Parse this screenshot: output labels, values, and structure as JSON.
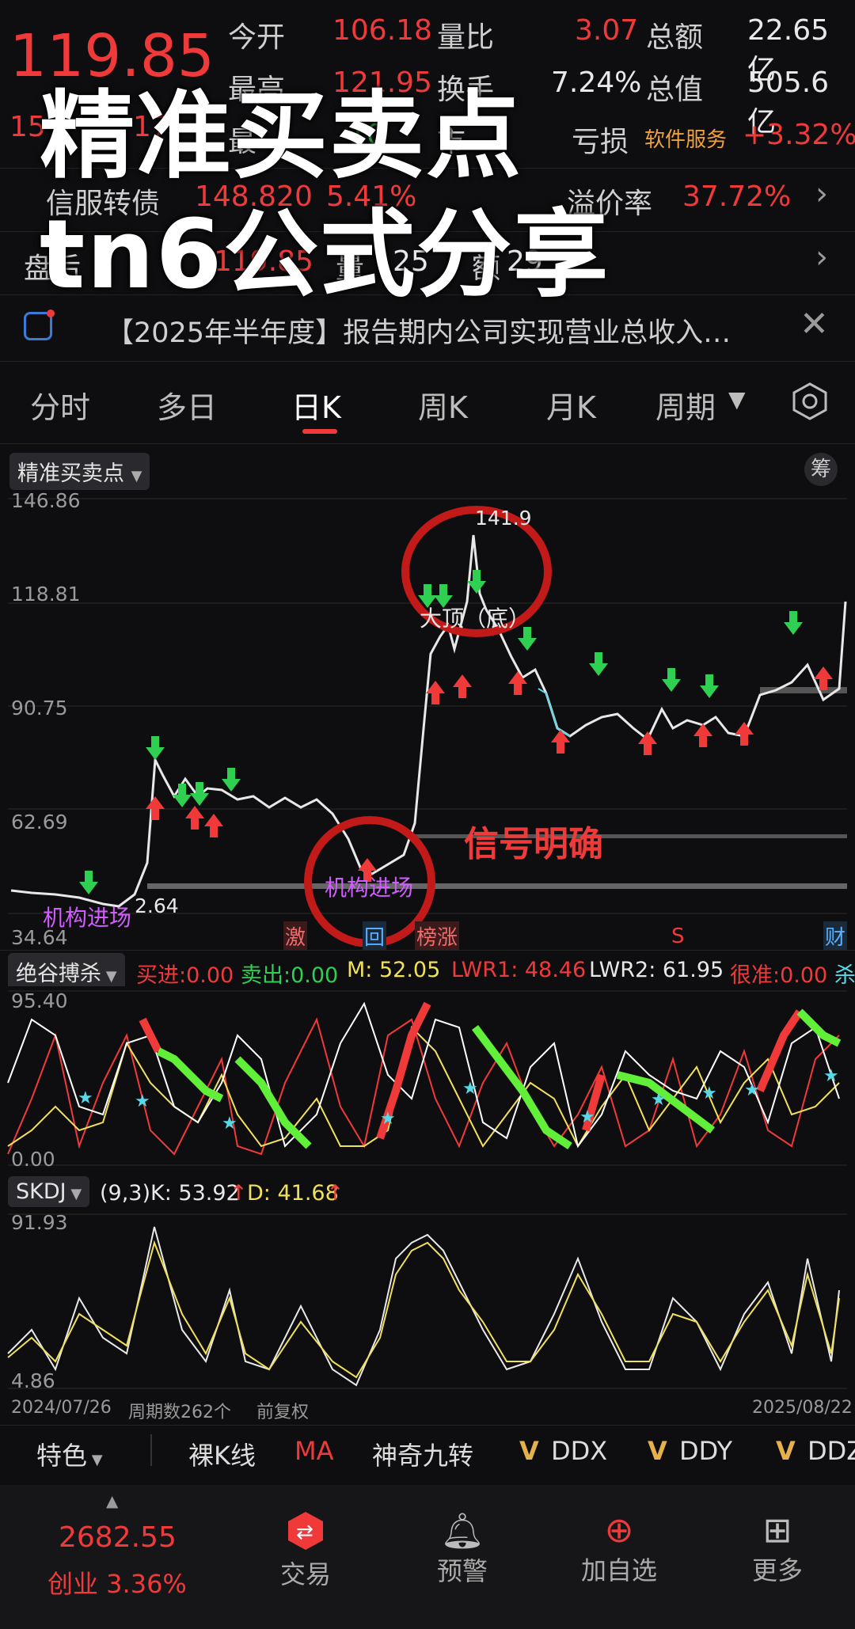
{
  "quote": {
    "price": "119.85",
    "change_partial_left": "15",
    "change_partial_right": "17",
    "rows": [
      {
        "label1": "今开",
        "val1": "106.18",
        "label2": "量比",
        "val2": "3.07",
        "label3": "总额",
        "val3": "22.65亿"
      },
      {
        "label1": "最高",
        "val1": "121.95",
        "label2": "换手",
        "val2": "7.24%",
        "label3": "总值",
        "val3": "505.6亿"
      }
    ],
    "row3": {
      "label1": "最",
      "val1": "10",
      "label2": "市",
      "loss_label": "亏损",
      "industry": "软件服务",
      "industry_change": "+3.32%"
    },
    "bond": {
      "name": "信服转债",
      "price": "148.820",
      "change": "5.41%",
      "premium_label": "溢价率",
      "premium": "37.72%"
    },
    "after_hours": {
      "label": "盘后",
      "val1": "119.85",
      "mid": "量",
      "val2": "25",
      "mid2": "额",
      "val3": "29"
    }
  },
  "overlay": {
    "line1": "精准买卖点",
    "line2": "tn6公式分享"
  },
  "news": {
    "text": "【2025年半年度】报告期内公司实现营业总收入…"
  },
  "tabs": [
    "分时",
    "多日",
    "日K",
    "周K",
    "月K",
    "周期"
  ],
  "active_tab": "日K",
  "main_chart": {
    "indicator_name": "精准买卖点",
    "chip_label": "筹",
    "y_ticks": [
      "146.86",
      "118.81",
      "90.75",
      "62.69",
      "34.64"
    ],
    "high_label": "141.9",
    "low_label": "2.64",
    "annotations": {
      "top": "大顶（底）",
      "signal": "信号明确",
      "inst1": "机构进场",
      "inst2": "机构进场"
    },
    "events": [
      "激",
      "回",
      "榜涨",
      "S",
      "财"
    ]
  },
  "ind1": {
    "name": "绝谷搏杀",
    "buy": "买进:0.00",
    "sell": "卖出:0.00",
    "m": "M: 52.05",
    "lwr1": "LWR1: 48.46",
    "lwr2": "LWR2: 61.95",
    "hen": "很准:0.00",
    "sha": "杀",
    "top": "95.40",
    "bottom": "0.00"
  },
  "ind2": {
    "name": "SKDJ",
    "params": "(9,3)",
    "k": "K: 53.92",
    "d": "D: 41.68",
    "top": "91.93",
    "bottom": "4.86"
  },
  "axis": {
    "start": "2024/07/26",
    "count": "周期数262个",
    "adj": "前复权",
    "end": "2025/08/22"
  },
  "toolbar": {
    "special": "特色",
    "items": [
      "裸K线",
      "MA",
      "神奇九转",
      "DDX",
      "DDY",
      "DDZ"
    ]
  },
  "bottom": {
    "index_value": "2682.55",
    "index_name": "创业 3.36%",
    "tabs": [
      "交易",
      "预警",
      "加自选",
      "更多"
    ]
  },
  "chart_data": {
    "type": "line",
    "title": "",
    "ylim": [
      34.64,
      146.86
    ],
    "x": [
      "2024/07/26",
      "2025/08/22"
    ],
    "series": [
      {
        "name": "close",
        "values": [
          40,
          38,
          37,
          36,
          35,
          42,
          75,
          68,
          72,
          66,
          63,
          60,
          58,
          55,
          50,
          48,
          53,
          62,
          100,
          118,
          116,
          141.9,
          112,
          104,
          98,
          90,
          93,
          95,
          89,
          94,
          92,
          90,
          96,
          98,
          104,
          100,
          119.85
        ]
      }
    ]
  }
}
